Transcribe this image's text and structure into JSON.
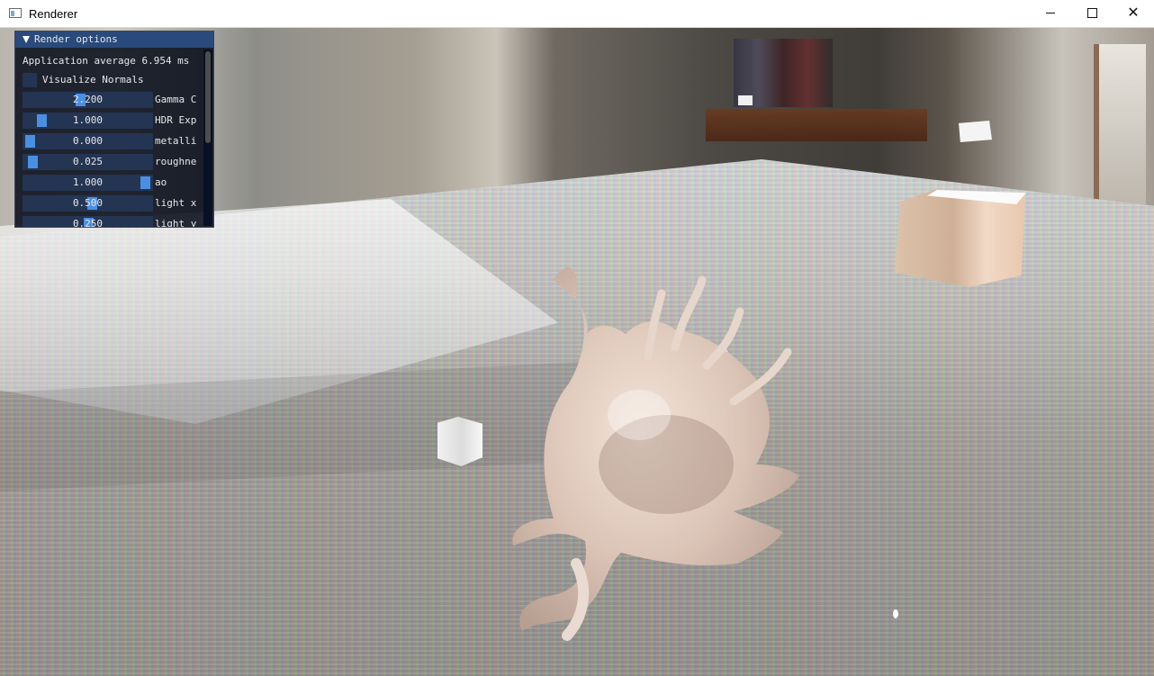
{
  "window": {
    "title": "Renderer",
    "controls": {
      "minimize": "minimize-icon",
      "maximize": "maximize-icon",
      "close": "close-icon"
    }
  },
  "panel": {
    "title": "Render options",
    "expanded": true,
    "average_text": "Application average 6.954 ms",
    "visualize_normals": {
      "label": "Visualize Normals",
      "checked": false
    },
    "sliders": [
      {
        "value": "2.200",
        "label": "Gamma C"
      },
      {
        "value": "1.000",
        "label": "HDR Exp"
      },
      {
        "value": "0.000",
        "label": "metalli"
      },
      {
        "value": "0.025",
        "label": "roughne"
      },
      {
        "value": "1.000",
        "label": "ao"
      },
      {
        "value": "0.500",
        "label": "light x"
      },
      {
        "value": "0.250",
        "label": "light y"
      }
    ]
  },
  "colors": {
    "panel_bg": "#070c1a",
    "panel_title_bg": "#294a7a",
    "slider_bg": "#243554",
    "slider_grab": "#4a90e2"
  }
}
